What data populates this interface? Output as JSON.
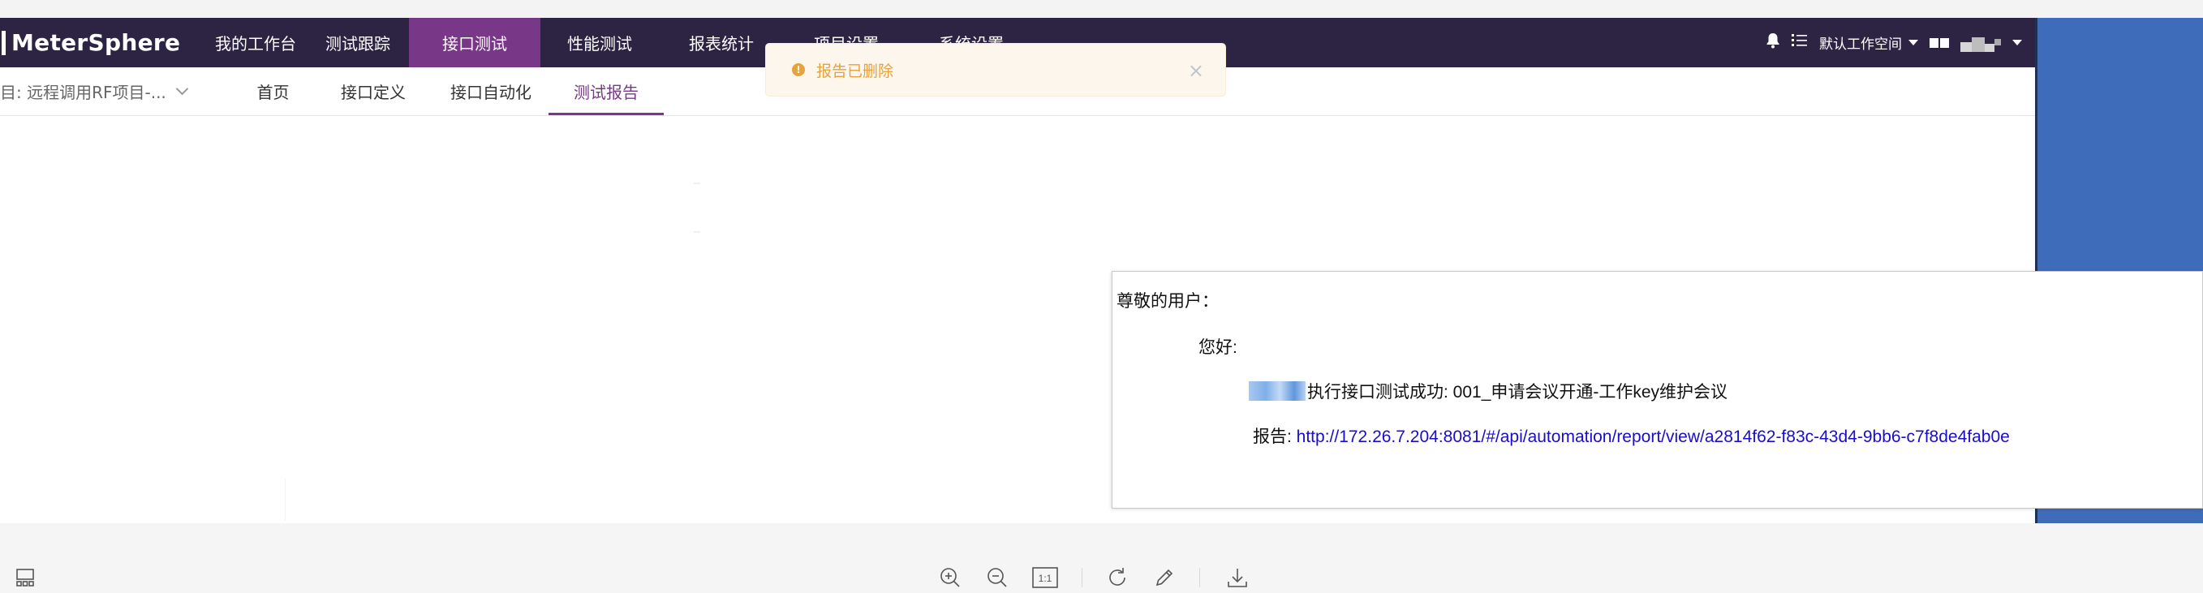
{
  "app": {
    "brand": "MeterSphere"
  },
  "topnav": {
    "items": [
      "我的工作台",
      "测试跟踪",
      "接口测试",
      "性能测试",
      "报表统计",
      "项目设置",
      "系统设置"
    ],
    "active_index": 2,
    "workspace": "默认工作空间"
  },
  "subnav": {
    "project": "目: 远程调用RF项目-...",
    "items": [
      "首页",
      "接口定义",
      "接口自动化",
      "测试报告"
    ],
    "active_index": 3
  },
  "toast": {
    "message": "报告已删除",
    "type": "warning"
  },
  "email": {
    "greeting": "尊敬的用户：",
    "hello": "您好:",
    "message": "执行接口测试成功: 001_申请会议开通-工作key维护会议",
    "report_label": "报告: ",
    "report_link": "http://172.26.7.204:8081/#/api/automation/report/view/a2814f62-f83c-43d4-9bb6-c7f8de4fab0e"
  },
  "toolbar": {
    "icons": [
      "layout-icon",
      "zoom-in-icon",
      "zoom-out-icon",
      "actual-size-icon",
      "rotate-icon",
      "edit-icon",
      "download-icon"
    ],
    "actual_size_label": "1:1"
  },
  "colors": {
    "nav_bg": "#2d2443",
    "accent": "#783887",
    "toast_text": "#e6a23c",
    "side_panel": "#3f6bbb"
  }
}
